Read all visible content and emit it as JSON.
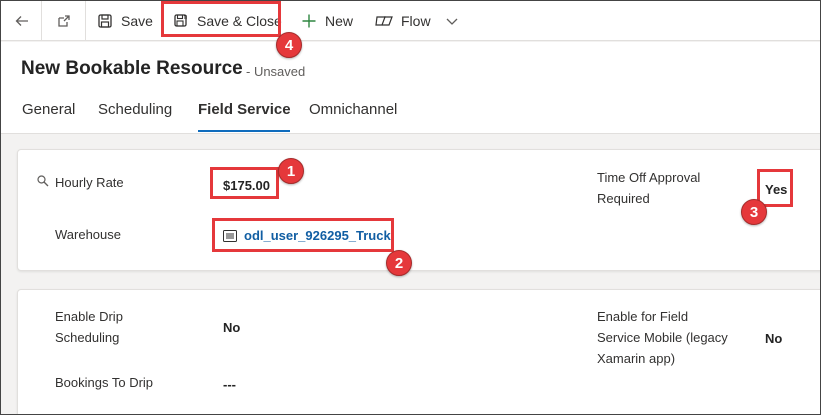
{
  "toolbar": {
    "save_label": "Save",
    "save_close_label": "Save & Close",
    "new_label": "New",
    "flow_label": "Flow"
  },
  "header": {
    "title": "New Bookable Resource",
    "status": "- Unsaved"
  },
  "tabs": [
    {
      "label": "General"
    },
    {
      "label": "Scheduling"
    },
    {
      "label": "Field Service",
      "active": true
    },
    {
      "label": "Omnichannel"
    }
  ],
  "section1": {
    "hourly_rate_label": "Hourly Rate",
    "hourly_rate_value": "$175.00",
    "warehouse_label": "Warehouse",
    "warehouse_value": "odl_user_926295_Truck",
    "time_off_label_line1": "Time Off Approval",
    "time_off_label_line2": "Required",
    "time_off_value": "Yes"
  },
  "section2": {
    "drip_label_line1": "Enable Drip",
    "drip_label_line2": "Scheduling",
    "drip_value": "No",
    "bookings_label": "Bookings To Drip",
    "bookings_value": "---",
    "mobile_label_line1": "Enable for Field",
    "mobile_label_line2": "Service Mobile (legacy",
    "mobile_label_line3": "Xamarin app)",
    "mobile_value": "No"
  },
  "annotations": {
    "badge_1": "1",
    "badge_2": "2",
    "badge_3": "3",
    "badge_4": "4"
  },
  "colors": {
    "highlight": "#e5383b",
    "accent": "#0f6cbd",
    "link": "#115ea3"
  },
  "icons": [
    "back-arrow-icon",
    "popout-icon",
    "save-icon",
    "save-close-icon",
    "plus-icon",
    "flow-icon",
    "chevron-down-icon",
    "lock-search-icon",
    "record-icon"
  ]
}
